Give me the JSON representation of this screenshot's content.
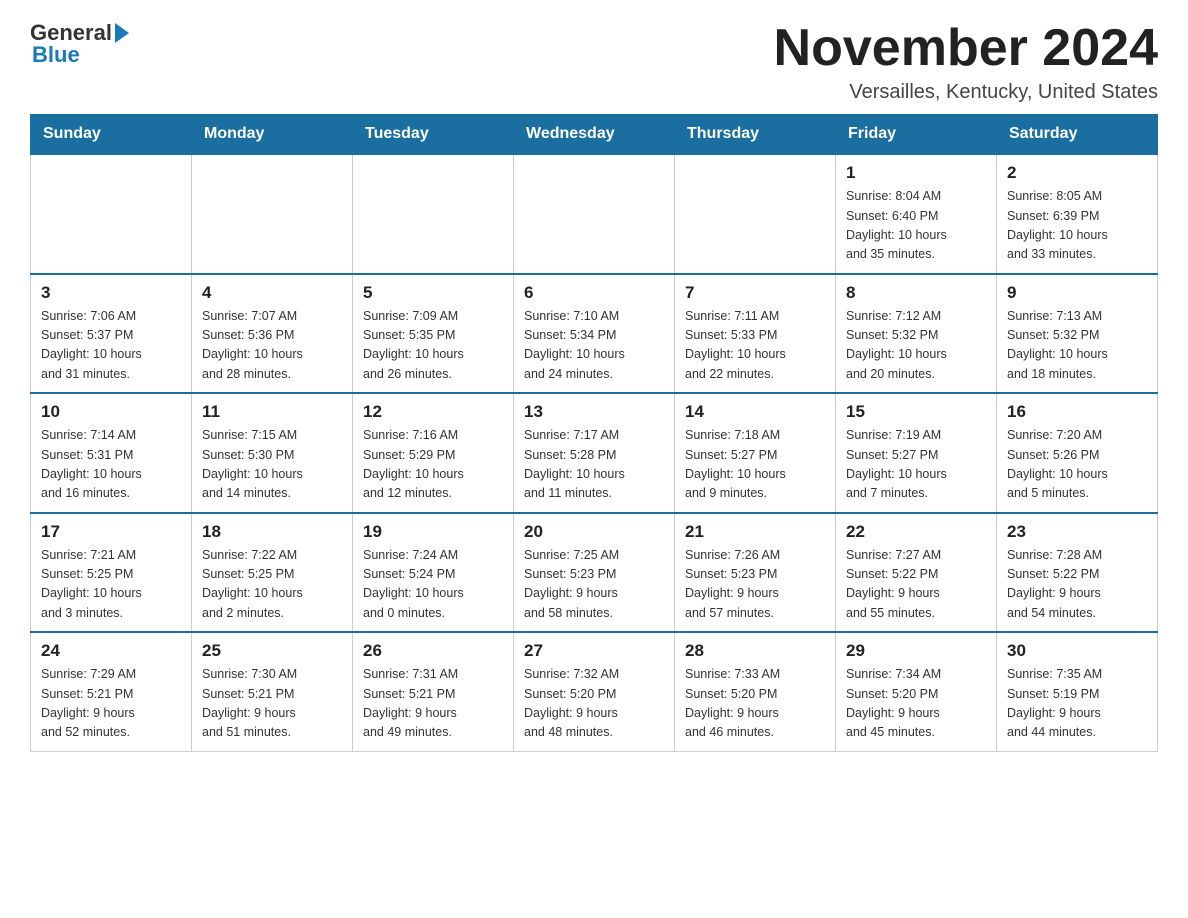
{
  "logo": {
    "general": "General",
    "blue": "Blue"
  },
  "header": {
    "title": "November 2024",
    "location": "Versailles, Kentucky, United States"
  },
  "weekdays": [
    "Sunday",
    "Monday",
    "Tuesday",
    "Wednesday",
    "Thursday",
    "Friday",
    "Saturday"
  ],
  "weeks": [
    [
      {
        "day": "",
        "info": ""
      },
      {
        "day": "",
        "info": ""
      },
      {
        "day": "",
        "info": ""
      },
      {
        "day": "",
        "info": ""
      },
      {
        "day": "",
        "info": ""
      },
      {
        "day": "1",
        "info": "Sunrise: 8:04 AM\nSunset: 6:40 PM\nDaylight: 10 hours\nand 35 minutes."
      },
      {
        "day": "2",
        "info": "Sunrise: 8:05 AM\nSunset: 6:39 PM\nDaylight: 10 hours\nand 33 minutes."
      }
    ],
    [
      {
        "day": "3",
        "info": "Sunrise: 7:06 AM\nSunset: 5:37 PM\nDaylight: 10 hours\nand 31 minutes."
      },
      {
        "day": "4",
        "info": "Sunrise: 7:07 AM\nSunset: 5:36 PM\nDaylight: 10 hours\nand 28 minutes."
      },
      {
        "day": "5",
        "info": "Sunrise: 7:09 AM\nSunset: 5:35 PM\nDaylight: 10 hours\nand 26 minutes."
      },
      {
        "day": "6",
        "info": "Sunrise: 7:10 AM\nSunset: 5:34 PM\nDaylight: 10 hours\nand 24 minutes."
      },
      {
        "day": "7",
        "info": "Sunrise: 7:11 AM\nSunset: 5:33 PM\nDaylight: 10 hours\nand 22 minutes."
      },
      {
        "day": "8",
        "info": "Sunrise: 7:12 AM\nSunset: 5:32 PM\nDaylight: 10 hours\nand 20 minutes."
      },
      {
        "day": "9",
        "info": "Sunrise: 7:13 AM\nSunset: 5:32 PM\nDaylight: 10 hours\nand 18 minutes."
      }
    ],
    [
      {
        "day": "10",
        "info": "Sunrise: 7:14 AM\nSunset: 5:31 PM\nDaylight: 10 hours\nand 16 minutes."
      },
      {
        "day": "11",
        "info": "Sunrise: 7:15 AM\nSunset: 5:30 PM\nDaylight: 10 hours\nand 14 minutes."
      },
      {
        "day": "12",
        "info": "Sunrise: 7:16 AM\nSunset: 5:29 PM\nDaylight: 10 hours\nand 12 minutes."
      },
      {
        "day": "13",
        "info": "Sunrise: 7:17 AM\nSunset: 5:28 PM\nDaylight: 10 hours\nand 11 minutes."
      },
      {
        "day": "14",
        "info": "Sunrise: 7:18 AM\nSunset: 5:27 PM\nDaylight: 10 hours\nand 9 minutes."
      },
      {
        "day": "15",
        "info": "Sunrise: 7:19 AM\nSunset: 5:27 PM\nDaylight: 10 hours\nand 7 minutes."
      },
      {
        "day": "16",
        "info": "Sunrise: 7:20 AM\nSunset: 5:26 PM\nDaylight: 10 hours\nand 5 minutes."
      }
    ],
    [
      {
        "day": "17",
        "info": "Sunrise: 7:21 AM\nSunset: 5:25 PM\nDaylight: 10 hours\nand 3 minutes."
      },
      {
        "day": "18",
        "info": "Sunrise: 7:22 AM\nSunset: 5:25 PM\nDaylight: 10 hours\nand 2 minutes."
      },
      {
        "day": "19",
        "info": "Sunrise: 7:24 AM\nSunset: 5:24 PM\nDaylight: 10 hours\nand 0 minutes."
      },
      {
        "day": "20",
        "info": "Sunrise: 7:25 AM\nSunset: 5:23 PM\nDaylight: 9 hours\nand 58 minutes."
      },
      {
        "day": "21",
        "info": "Sunrise: 7:26 AM\nSunset: 5:23 PM\nDaylight: 9 hours\nand 57 minutes."
      },
      {
        "day": "22",
        "info": "Sunrise: 7:27 AM\nSunset: 5:22 PM\nDaylight: 9 hours\nand 55 minutes."
      },
      {
        "day": "23",
        "info": "Sunrise: 7:28 AM\nSunset: 5:22 PM\nDaylight: 9 hours\nand 54 minutes."
      }
    ],
    [
      {
        "day": "24",
        "info": "Sunrise: 7:29 AM\nSunset: 5:21 PM\nDaylight: 9 hours\nand 52 minutes."
      },
      {
        "day": "25",
        "info": "Sunrise: 7:30 AM\nSunset: 5:21 PM\nDaylight: 9 hours\nand 51 minutes."
      },
      {
        "day": "26",
        "info": "Sunrise: 7:31 AM\nSunset: 5:21 PM\nDaylight: 9 hours\nand 49 minutes."
      },
      {
        "day": "27",
        "info": "Sunrise: 7:32 AM\nSunset: 5:20 PM\nDaylight: 9 hours\nand 48 minutes."
      },
      {
        "day": "28",
        "info": "Sunrise: 7:33 AM\nSunset: 5:20 PM\nDaylight: 9 hours\nand 46 minutes."
      },
      {
        "day": "29",
        "info": "Sunrise: 7:34 AM\nSunset: 5:20 PM\nDaylight: 9 hours\nand 45 minutes."
      },
      {
        "day": "30",
        "info": "Sunrise: 7:35 AM\nSunset: 5:19 PM\nDaylight: 9 hours\nand 44 minutes."
      }
    ]
  ]
}
